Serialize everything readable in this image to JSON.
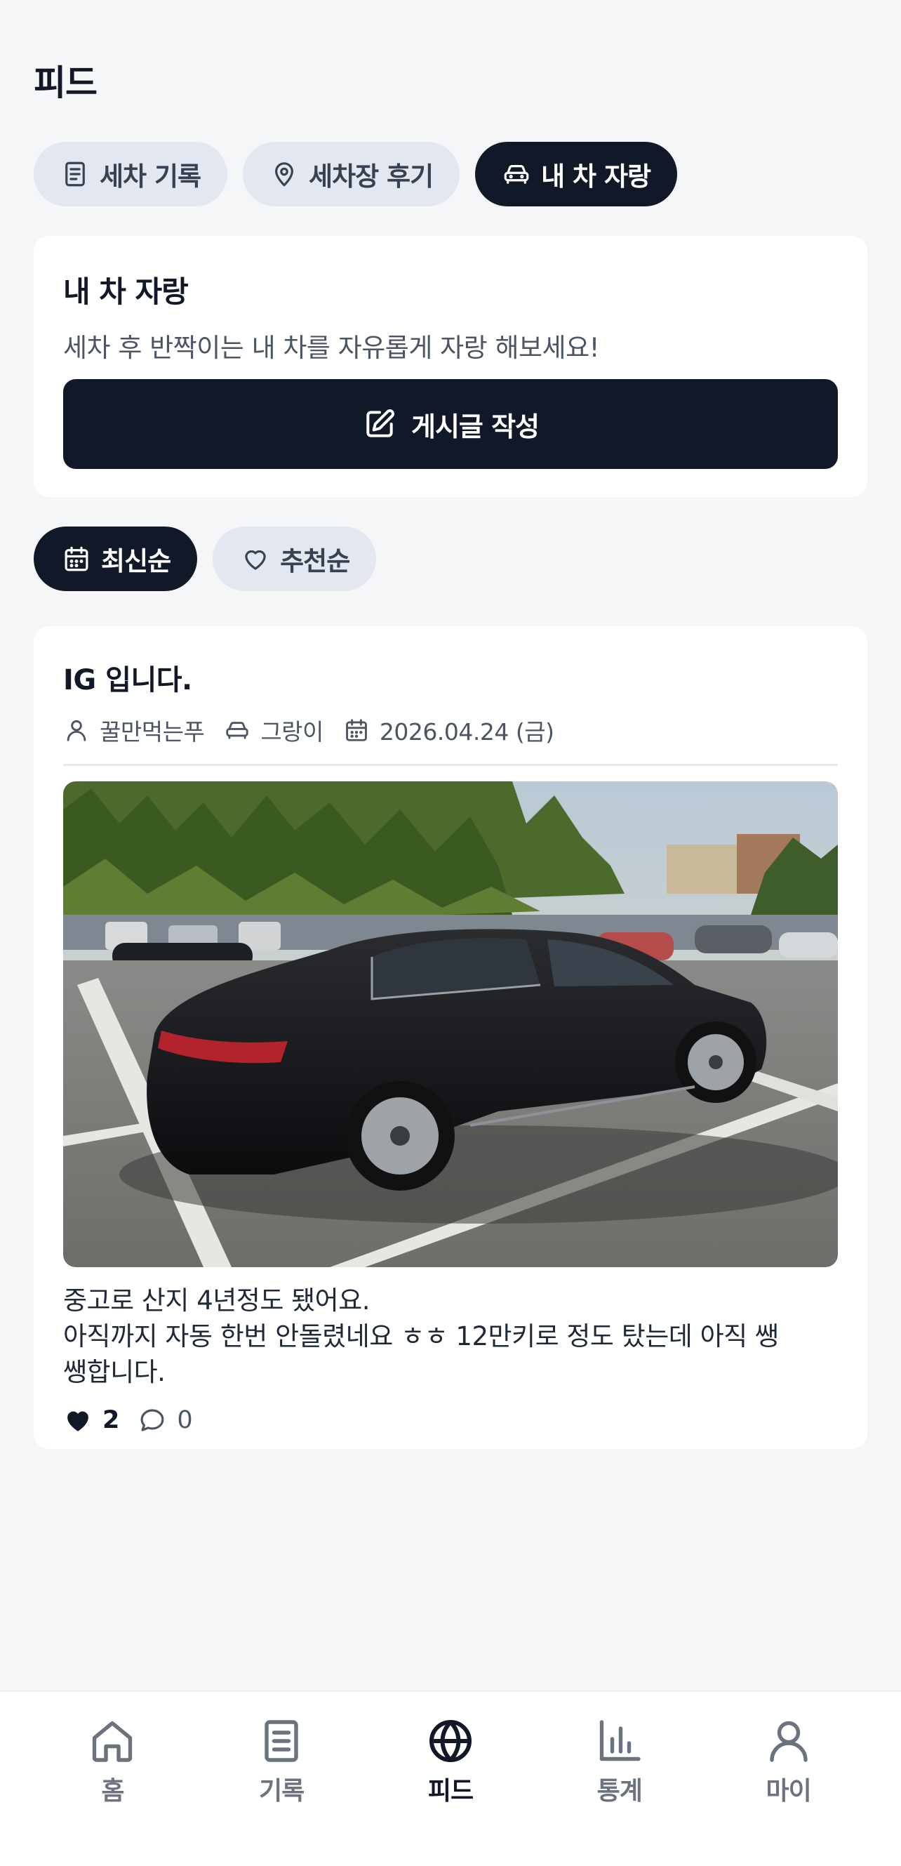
{
  "header": {
    "title": "피드"
  },
  "category_tabs": [
    {
      "label": "세차 기록",
      "icon": "document-icon",
      "active": false
    },
    {
      "label": "세차장 후기",
      "icon": "map-pin-icon",
      "active": false
    },
    {
      "label": "내 차 자랑",
      "icon": "car-icon",
      "active": true
    }
  ],
  "intro": {
    "title": "내 차 자랑",
    "description": "세차 후 반짝이는 내 차를 자유롭게 자랑 해보세요!",
    "write_button": "게시글 작성",
    "write_icon": "pencil-square-icon"
  },
  "sort_tabs": [
    {
      "label": "최신순",
      "icon": "calendar-icon",
      "active": true
    },
    {
      "label": "추천순",
      "icon": "heart-icon",
      "active": false
    }
  ],
  "post": {
    "title": "IG 입니다.",
    "author": "꿀만먹는푸",
    "car_name": "그랑이",
    "date": "2026.04.24 (금)",
    "body_lines": [
      "중고로 산지 4년정도 됐어요.",
      "아직까지 자동 한번 안돌렸네요 ㅎㅎ 12만키로 정도 탔는데 아직 쌩",
      "쌩합니다."
    ],
    "likes": "2",
    "comments": "0"
  },
  "bottom_nav": [
    {
      "label": "홈",
      "icon": "home-icon",
      "active": false
    },
    {
      "label": "기록",
      "icon": "book-icon",
      "active": false
    },
    {
      "label": "피드",
      "icon": "globe-icon",
      "active": true
    },
    {
      "label": "통계",
      "icon": "bar-chart-icon",
      "active": false
    },
    {
      "label": "마이",
      "icon": "user-icon",
      "active": false
    }
  ],
  "colors": {
    "primary": "#111827",
    "chip_bg": "#e3e7ef",
    "background": "#f5f6f8"
  }
}
